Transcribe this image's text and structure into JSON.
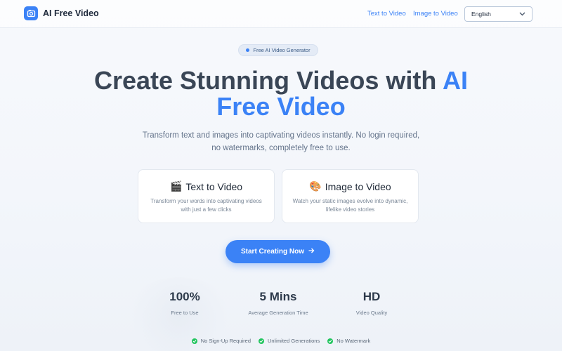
{
  "header": {
    "brand": "AI Free Video",
    "logo_icon": "video-camera-icon",
    "nav": [
      {
        "label": "Text to Video"
      },
      {
        "label": "Image to Video"
      }
    ],
    "language": {
      "selected": "English"
    }
  },
  "badge": {
    "label": "Free AI Video Generator"
  },
  "hero": {
    "title_line1": "Create Stunning Videos with ",
    "title_accent1": "AI",
    "title_accent2": "Free Video",
    "subtitle": "Transform text and images into captivating videos instantly. No login required, no watermarks, completely free to use."
  },
  "cards": [
    {
      "emoji": "🎬",
      "title": "Text to Video",
      "desc": "Transform your words into captivating videos with just a few clicks"
    },
    {
      "emoji": "🎨",
      "title": "Image to Video",
      "desc": "Watch your static images evolve into dynamic, lifelike video stories"
    }
  ],
  "cta": {
    "label": "Start Creating Now",
    "icon": "arrow-right-icon"
  },
  "stats": [
    {
      "value": "100%",
      "label": "Free to Use"
    },
    {
      "value": "5 Mins",
      "label": "Average Generation Time"
    },
    {
      "value": "HD",
      "label": "Video Quality"
    }
  ],
  "features": [
    {
      "label": "No Sign-Up Required"
    },
    {
      "label": "Unlimited Generations"
    },
    {
      "label": "No Watermark"
    }
  ],
  "colors": {
    "accent": "#3b82f6",
    "check": "#22c55e",
    "title": "#3a4656"
  }
}
